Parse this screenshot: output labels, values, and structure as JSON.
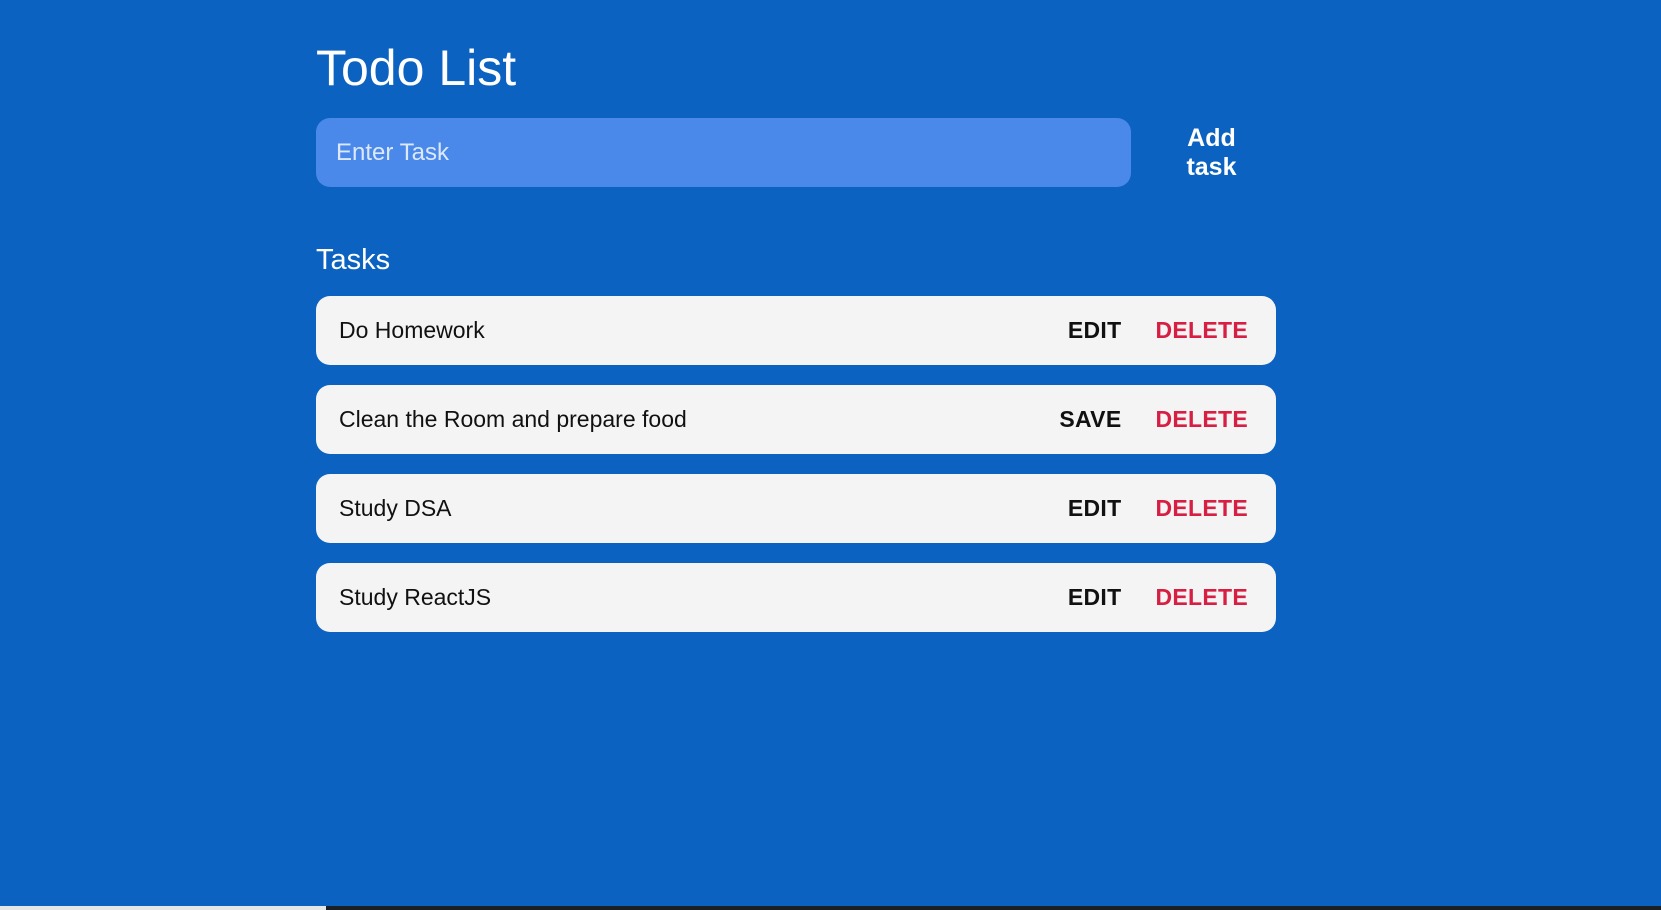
{
  "header": {
    "title": "Todo List"
  },
  "add_task": {
    "placeholder": "Enter Task",
    "value": "",
    "button_label": "Add task"
  },
  "tasks_section": {
    "title": "Tasks",
    "items": [
      {
        "text": "Do Homework",
        "action_label": "EDIT",
        "delete_label": "DELETE",
        "editing": false
      },
      {
        "text": "Clean the Room and prepare food",
        "action_label": "SAVE",
        "delete_label": "DELETE",
        "editing": true
      },
      {
        "text": "Study DSA",
        "action_label": "EDIT",
        "delete_label": "DELETE",
        "editing": false
      },
      {
        "text": "Study ReactJS",
        "action_label": "EDIT",
        "delete_label": "DELETE",
        "editing": false
      }
    ]
  },
  "colors": {
    "background": "#0b62c1",
    "input_background": "#4a89ea",
    "card_background": "#f4f4f4",
    "delete_color": "#d61f43"
  }
}
